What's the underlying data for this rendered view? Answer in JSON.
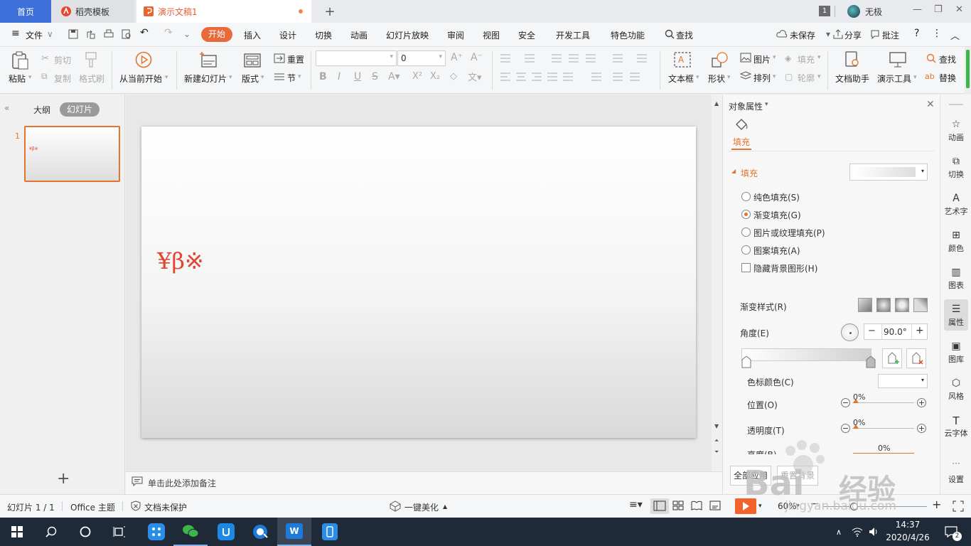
{
  "tabs": {
    "home": "首页",
    "templates": "稻壳模板",
    "doc": "演示文稿1"
  },
  "window": {
    "page_badge": "1",
    "user": "无极"
  },
  "menu": {
    "file": "文件",
    "start": "开始",
    "insert": "插入",
    "design": "设计",
    "transition": "切换",
    "animation": "动画",
    "slideshow": "幻灯片放映",
    "review": "审阅",
    "view": "视图",
    "security": "安全",
    "devtools": "开发工具",
    "features": "特色功能",
    "search": "查找",
    "unsaved": "未保存",
    "share": "分享",
    "annotate": "批注"
  },
  "ribbon": {
    "paste": "粘贴",
    "cut": "剪切",
    "copy": "复制",
    "format_painter": "格式刷",
    "play_from_current": "从当前开始",
    "new_slide": "新建幻灯片",
    "layout": "版式",
    "reset": "重置",
    "section": "节",
    "font_size": "0",
    "text_box": "文本框",
    "shape": "形状",
    "picture": "图片",
    "arrange": "排列",
    "fill": "填充",
    "outline": "轮廓",
    "doc_assistant": "文档助手",
    "present_tools": "演示工具",
    "find": "查找",
    "replace": "替换"
  },
  "left_pane": {
    "outline_tab": "大纲",
    "slides_tab": "幻灯片",
    "slide_number": "1",
    "thumb_text": "¥β※"
  },
  "slide": {
    "text": "¥β※",
    "accent": "#e2452e"
  },
  "notes": {
    "placeholder": "单击此处添加备注"
  },
  "props": {
    "title": "对象属性",
    "fill_tab": "填充",
    "fill_section": "填充",
    "solid": "纯色填充(S)",
    "gradient": "渐变填充(G)",
    "picture_texture": "图片或纹理填充(P)",
    "pattern": "图案填充(A)",
    "hide_bg": "隐藏背景图形(H)",
    "gradient_style": "渐变样式(R)",
    "angle": "角度(E)",
    "angle_value": "90.0°",
    "stop_color": "色标颜色(C)",
    "position": "位置(O)",
    "position_value": "0%",
    "transparency": "透明度(T)",
    "transparency_value": "0%",
    "brightness": "亮度(B)",
    "brightness_value": "0%",
    "apply_all": "全部应用",
    "reset_bg": "重置背景",
    "selected_option": "gradient"
  },
  "rail": {
    "animation": "动画",
    "transition": "切换",
    "art_text": "艺术字",
    "color": "颜色",
    "chart": "图表",
    "properties": "属性",
    "gallery": "图库",
    "style": "风格",
    "cloud_font": "云字体",
    "settings": "设置"
  },
  "status": {
    "slide_info": "幻灯片 1 / 1",
    "theme": "Office 主题",
    "protection": "文档未保护",
    "beautify": "一键美化",
    "zoom": "60%"
  },
  "taskbar": {
    "time": "14:37",
    "date": "2020/4/26",
    "notifications": "2"
  },
  "watermark": {
    "brand": "Bai",
    "brand2": "经验",
    "url": "jingyan.baidu.com"
  },
  "colors": {
    "accent_orange": "#e86a3a",
    "home_tab": "#3d6fd9",
    "taskbar": "#1f2a38"
  }
}
